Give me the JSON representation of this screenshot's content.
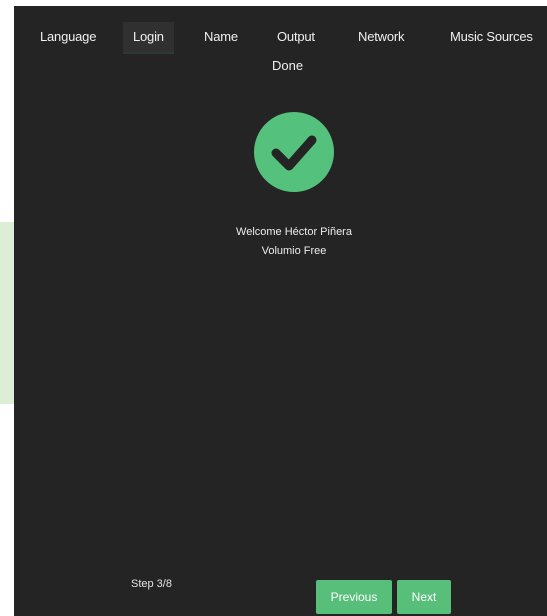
{
  "tabs": [
    {
      "label": "Language"
    },
    {
      "label": "Login"
    },
    {
      "label": "Name"
    },
    {
      "label": "Output"
    },
    {
      "label": "Network"
    },
    {
      "label": "Music Sources"
    }
  ],
  "done_tab": {
    "label": "Done"
  },
  "active_tab": "Login",
  "status": {
    "icon": "check-circle-icon",
    "welcome_line": "Welcome Héctor Piñera",
    "plan_line": "Volumio Free"
  },
  "footer": {
    "step_label": "Step 3/8",
    "previous_label": "Previous",
    "next_label": "Next"
  },
  "colors": {
    "background": "#242424",
    "accent": "#58bf7b",
    "text": "#f2f2f2"
  }
}
